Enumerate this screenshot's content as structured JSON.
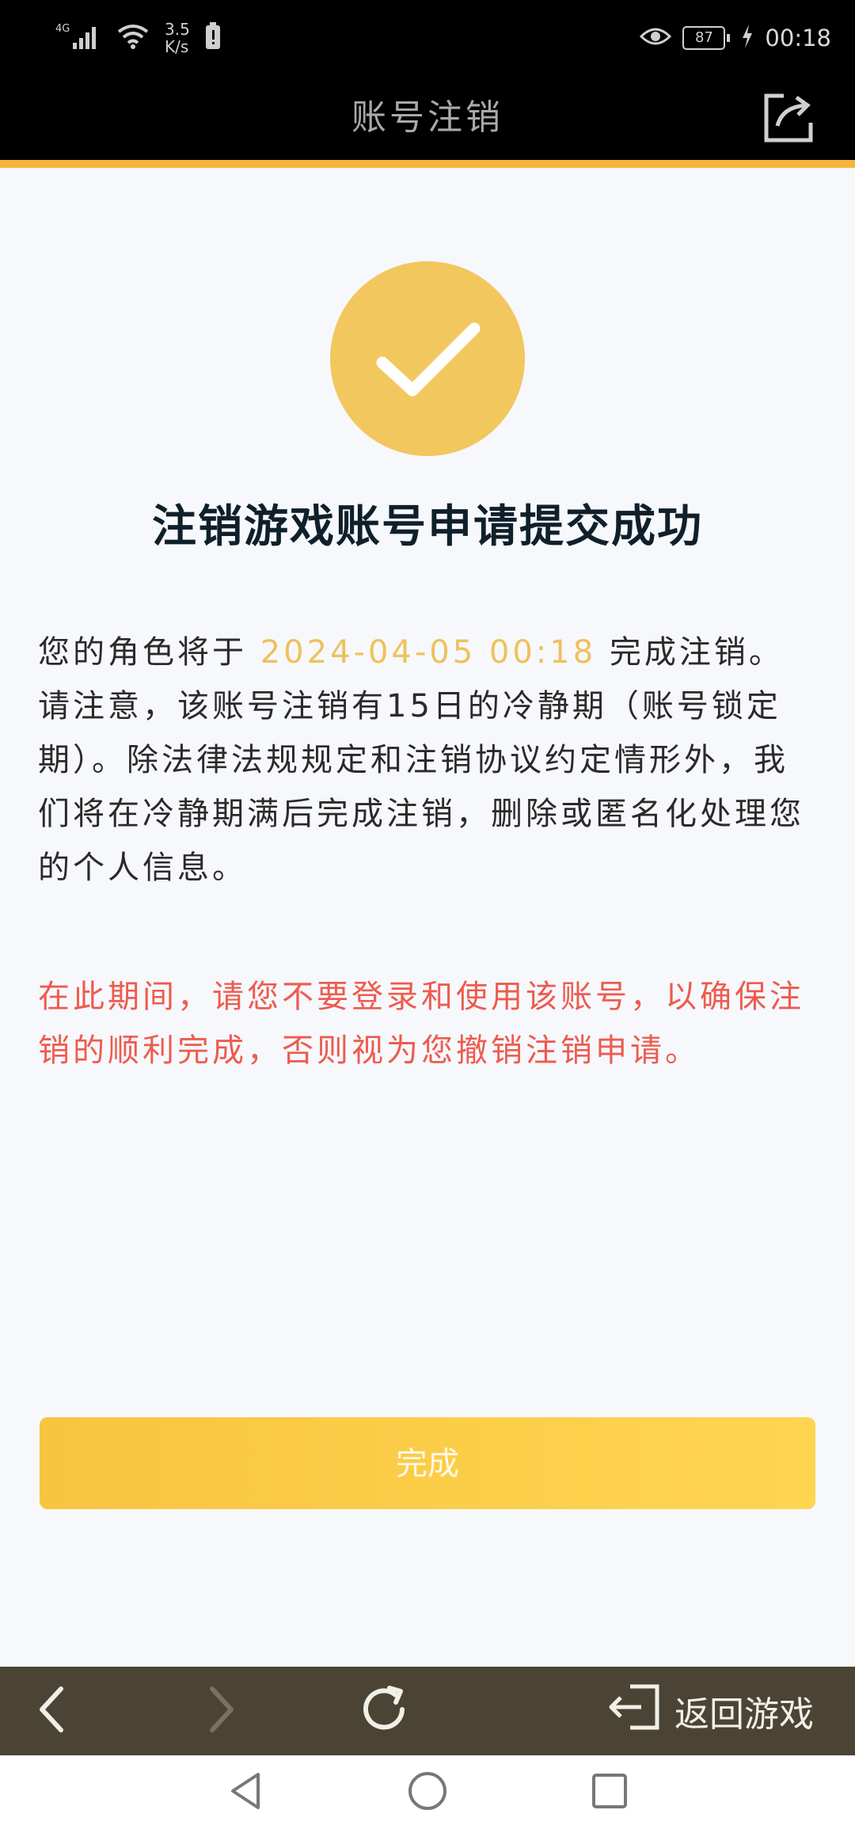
{
  "status_bar": {
    "network_label": "4G",
    "speed_value": "3.5",
    "speed_unit": "K/s",
    "battery_level": "87",
    "time": "00:18"
  },
  "header": {
    "title": "账号注销"
  },
  "main": {
    "success_title": "注销游戏账号申请提交成功",
    "description_prefix": "您的角色将于 ",
    "description_date": "2024-04-05 00:18",
    "description_suffix": " 完成注销。请注意，该账号注销有15日的冷静期（账号锁定期）。除法律法规规定和注销协议约定情形外，我们将在冷静期满后完成注销，删除或匿名化处理您的个人信息。",
    "warning": "在此期间，请您不要登录和使用该账号，以确保注销的顺利完成，否则视为您撤销注销申请。",
    "done_button": "完成"
  },
  "browser_toolbar": {
    "back_to_game": "返回游戏"
  },
  "colors": {
    "accent": "#f6b63c",
    "success_circle": "#f2c75e",
    "date_highlight": "#efc15c",
    "warning": "#ee5b4e",
    "button": "#f7c540",
    "toolbar": "#4b4434"
  }
}
